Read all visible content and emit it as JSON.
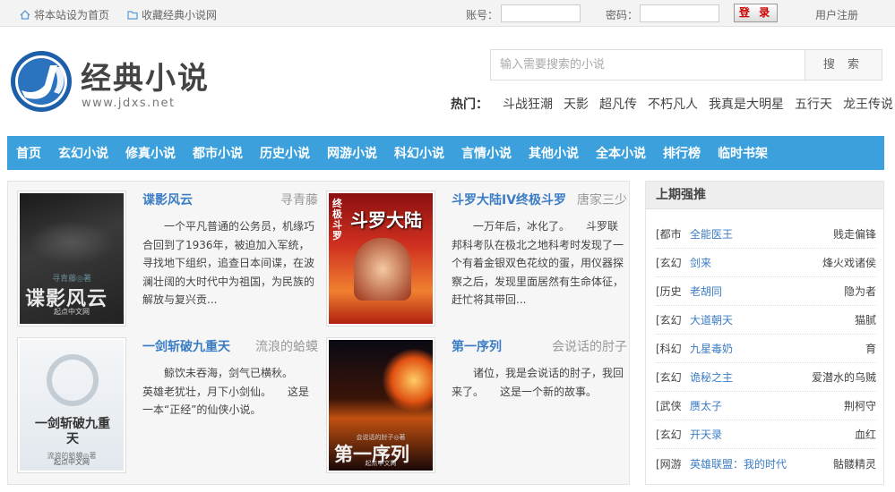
{
  "topbar": {
    "set_home": "将本站设为首页",
    "bookmark": "收藏经典小说网",
    "account_label": "账号：",
    "password_label": "密码：",
    "login": "登 录",
    "register": "用户注册"
  },
  "logo": {
    "title": "经典小说",
    "url": "www.jdxs.net",
    "mark": "JD"
  },
  "search": {
    "placeholder": "输入需要搜索的小说",
    "button": "搜 索"
  },
  "hot": {
    "label": "热门：",
    "items": [
      "斗战狂潮",
      "天影",
      "超凡传",
      "不朽凡人",
      "我真是大明星",
      "五行天",
      "龙王传说"
    ]
  },
  "nav": [
    "首页",
    "玄幻小说",
    "修真小说",
    "都市小说",
    "历史小说",
    "网游小说",
    "科幻小说",
    "言情小说",
    "其他小说",
    "全本小说",
    "排行榜",
    "临时书架"
  ],
  "books": [
    {
      "title": "谍影风云",
      "author": "寻青藤",
      "desc": "一个平凡普通的公务员，机缘巧合回到了1936年，被迫加入军统，寻找地下组织，追查日本间谍，在波澜壮阔的大时代中为祖国，为民族的解放与复兴贡...",
      "cover_text": "谍影风云",
      "cover_author": "寻青藤◎著",
      "cover_pub": "起点中文网"
    },
    {
      "title": "斗罗大陆IV终极斗罗",
      "author": "唐家三少",
      "desc": "一万年后，冰化了。　　斗罗联邦科考队在极北之地科考时发现了一个有着金银双色花纹的蛋，用仪器探察之后，发现里面居然有生命体征，赶忙将其带回...",
      "cover_text": "斗罗大陆",
      "cover_sub": "终极斗罗"
    },
    {
      "title": "一剑斩破九重天",
      "author": "流浪的蛤蟆",
      "desc": "鲸饮未吞海，剑气已横秋。　　英雄老犹壮，月下小剑仙。　　这是一本“正经”的仙侠小说。",
      "cover_text": "一剑斩破九重天",
      "cover_author": "流浪的蛤蟆◎著",
      "cover_pub": "起点中文网"
    },
    {
      "title": "第一序列",
      "author": "会说话的肘子",
      "desc": "诸位，我是会说话的肘子，我回来了。　　这是一个新的故事。",
      "cover_text": "第一序列",
      "cover_author": "会说话的肘子◎著",
      "cover_pub": "起点中文网"
    }
  ],
  "sidebar": {
    "title": "上期强推",
    "rows": [
      {
        "cat": "[都市",
        "name": "全能医王",
        "author": "贱走偏锋"
      },
      {
        "cat": "[玄幻",
        "name": "剑来",
        "author": "烽火戏诸侯"
      },
      {
        "cat": "[历史",
        "name": "老胡同",
        "author": "隐为者"
      },
      {
        "cat": "[玄幻",
        "name": "大道朝天",
        "author": "猫腻"
      },
      {
        "cat": "[科幻",
        "name": "九星毒奶",
        "author": "育"
      },
      {
        "cat": "[玄幻",
        "name": "诡秘之主",
        "author": "爱潜水的乌贼"
      },
      {
        "cat": "[武侠",
        "name": "赝太子",
        "author": "荆柯守"
      },
      {
        "cat": "[玄幻",
        "name": "开天录",
        "author": "血红"
      },
      {
        "cat": "[网游",
        "name": "英雄联盟：我的时代",
        "author": "骷髅精灵"
      }
    ]
  },
  "colors": {
    "nav_bg": "#3ba0dc",
    "link": "#3b7dc4",
    "login_text": "#cc0000"
  }
}
